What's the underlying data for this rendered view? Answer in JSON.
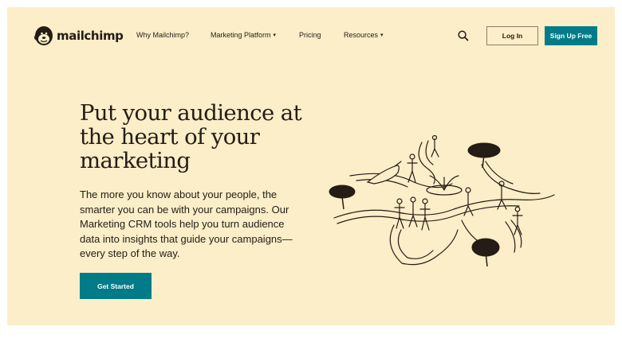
{
  "brand": {
    "name": "mailchimp",
    "accent_color": "#007c89",
    "background_color": "#fbeec8"
  },
  "nav": {
    "items": [
      {
        "label": "Why Mailchimp?",
        "has_dropdown": false
      },
      {
        "label": "Marketing Platform",
        "has_dropdown": true
      },
      {
        "label": "Pricing",
        "has_dropdown": false
      },
      {
        "label": "Resources",
        "has_dropdown": true
      }
    ],
    "dropdown_glyph": "▾",
    "search_icon": "search-icon",
    "login_label": "Log In",
    "signup_label": "Sign Up Free"
  },
  "hero": {
    "title_lines": [
      "Put your audience at",
      "the heart of your",
      "marketing"
    ],
    "body_lines": [
      "The more you know about your people, the",
      "smarter you can be with your campaigns. Our",
      "Marketing CRM tools help you turn audience",
      "data into insights that guide your campaigns—",
      "every step of the way."
    ],
    "cta_label": "Get Started"
  },
  "illustration": {
    "icon": "people-on-paths-illustration"
  }
}
